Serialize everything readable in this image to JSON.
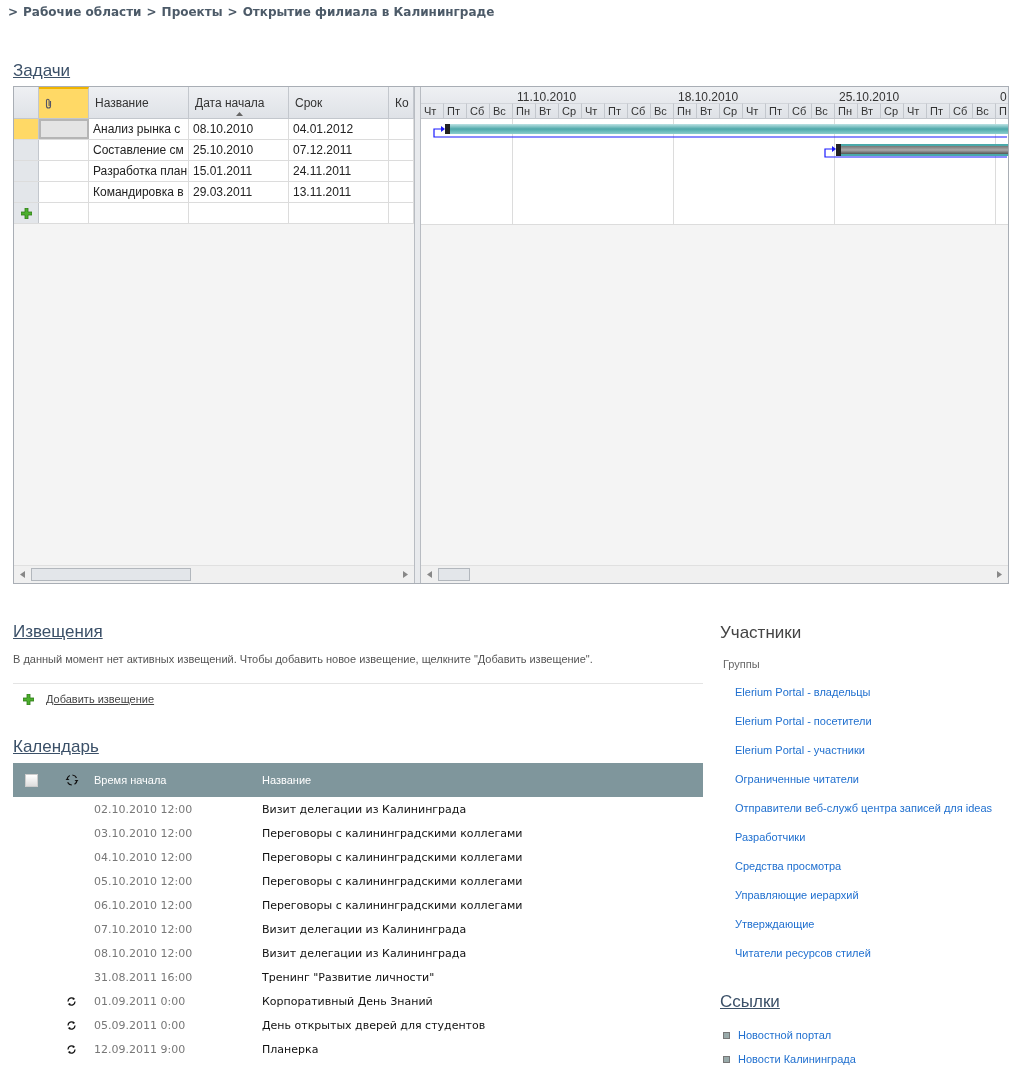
{
  "breadcrumb": {
    "separator": ">",
    "items": [
      "Рабочие области",
      "Проекты",
      "Открытие филиала в Калининграде"
    ]
  },
  "tasks": {
    "title": "Задачи",
    "columns": [
      {
        "kind": "attachment",
        "selected": true
      },
      {
        "kind": "text",
        "label": "Название",
        "sorted": false
      },
      {
        "kind": "text",
        "label": "Дата начала",
        "sorted": true
      },
      {
        "kind": "text",
        "label": "Срок",
        "sorted": false
      },
      {
        "kind": "text",
        "label": "Ко",
        "sorted": false
      }
    ],
    "rows": [
      {
        "selected": true,
        "name": "Анализ рынка с",
        "start": "08.10.2010",
        "due": "04.01.2012",
        "kind": "normal"
      },
      {
        "selected": false,
        "name": "Составление см",
        "start": "25.10.2010",
        "due": "07.12.2011",
        "kind": "summary"
      },
      {
        "selected": false,
        "name": "Разработка план",
        "start": "15.01.2011",
        "due": "24.11.2011",
        "kind": "normal"
      },
      {
        "selected": false,
        "name": "Командировка в",
        "start": "29.03.2011",
        "due": "13.11.2011",
        "kind": "normal"
      }
    ],
    "gantt": {
      "lead_days": [
        "Чт",
        "Пт",
        "Сб",
        "Вс"
      ],
      "weeks": [
        {
          "label": "11.10.2010",
          "days": [
            "Пн",
            "Вт",
            "Ср",
            "Чт",
            "Пт",
            "Сб",
            "Вс"
          ]
        },
        {
          "label": "18.10.2010",
          "days": [
            "Пн",
            "Вт",
            "Ср",
            "Чт",
            "Пт",
            "Сб",
            "Вс"
          ]
        },
        {
          "label": "25.10.2010",
          "days": [
            "Пн",
            "Вт",
            "Ср",
            "Чт",
            "Пт",
            "Сб",
            "Вс"
          ]
        },
        {
          "label": "0",
          "days": [
            "П"
          ]
        }
      ]
    }
  },
  "notices": {
    "title": "Извещения",
    "message": "В данный момент нет активных извещений. Чтобы добавить новое извещение, щелкните \"Добавить извещение\".",
    "add_link": "Добавить извещение"
  },
  "calendar": {
    "title": "Календарь",
    "checked": false,
    "columns": [
      "Время начала",
      "Название"
    ],
    "rows": [
      {
        "recurring": false,
        "start": "02.10.2010 12:00",
        "name": "Визит делегации из Калининграда"
      },
      {
        "recurring": false,
        "start": "03.10.2010 12:00",
        "name": "Переговоры с калининградскими коллегами"
      },
      {
        "recurring": false,
        "start": "04.10.2010 12:00",
        "name": "Переговоры с калининградскими коллегами"
      },
      {
        "recurring": false,
        "start": "05.10.2010 12:00",
        "name": "Переговоры с калининградскими коллегами"
      },
      {
        "recurring": false,
        "start": "06.10.2010 12:00",
        "name": "Переговоры с калининградскими коллегами"
      },
      {
        "recurring": false,
        "start": "07.10.2010 12:00",
        "name": "Визит делегации из Калининграда"
      },
      {
        "recurring": false,
        "start": "08.10.2010 12:00",
        "name": "Визит делегации из Калининграда"
      },
      {
        "recurring": false,
        "start": "31.08.2011 16:00",
        "name": "Тренинг \"Развитие личности\""
      },
      {
        "recurring": true,
        "start": "01.09.2011 0:00",
        "name": "Корпоративный День Знаний"
      },
      {
        "recurring": true,
        "start": "05.09.2011 0:00",
        "name": "День открытых дверей для студентов"
      },
      {
        "recurring": true,
        "start": "12.09.2011 9:00",
        "name": "Планерка"
      }
    ]
  },
  "members": {
    "title": "Участники",
    "subtitle": "Группы",
    "groups": [
      "Elerium Portal - владельцы",
      "Elerium Portal - посетители",
      "Elerium Portal - участники",
      "Ограниченные читатели",
      "Отправители веб-служб центра записей для ideas",
      "Разработчики",
      "Средства просмотра",
      "Управляющие иерархий",
      "Утверждающие",
      "Читатели ресурсов стилей"
    ]
  },
  "links": {
    "title": "Ссылки",
    "items": [
      "Новостной портал",
      "Новости Калининграда"
    ]
  }
}
